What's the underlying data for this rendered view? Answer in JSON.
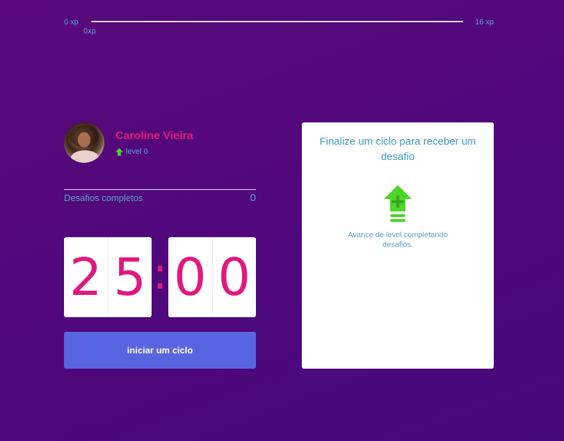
{
  "experience": {
    "min_label": "0 xp",
    "max_label": "16 xp",
    "current_label": "0xp",
    "progress_percent": 0
  },
  "profile": {
    "name": "Caroline Vieira",
    "level_label": "level 0"
  },
  "challenges": {
    "label": "Desafios completos",
    "count": "0"
  },
  "countdown": {
    "minute_left": "2",
    "minute_right": "5",
    "separator": ":",
    "second_left": "0",
    "second_right": "0"
  },
  "actions": {
    "start_label": "iniciar um ciclo"
  },
  "challenge_card": {
    "title": "Finalize um ciclo para receber um desafio",
    "hint": "Avance de level completando desafios."
  },
  "colors": {
    "accent_pink": "#e0197f",
    "accent_blue": "#5aa3d8",
    "button_blue": "#5965e0",
    "level_green": "#4cd62b",
    "background_purple": "#5a0a7a"
  },
  "icons": {
    "level": "level-up-arrow-icon",
    "card": "level-up-arrow-icon"
  }
}
